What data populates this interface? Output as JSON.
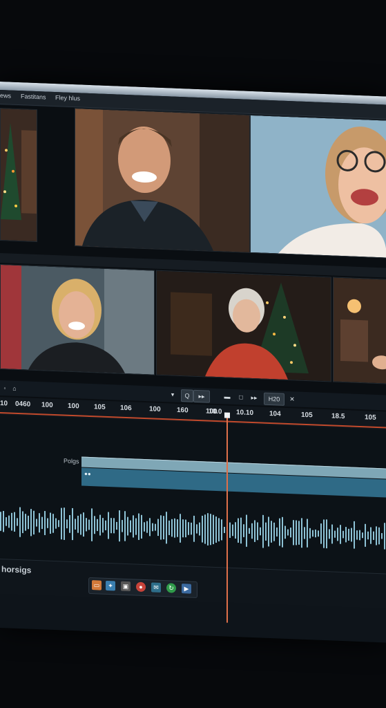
{
  "menu": {
    "items": [
      "ews",
      "Fastitans",
      "Fley hlus"
    ]
  },
  "toolbar": {
    "left_icons": [
      "◦",
      "⌂"
    ],
    "controls": [
      "▾",
      "Q",
      "▸▸",
      "▬",
      "□",
      "▸▸",
      "H20",
      "✕"
    ]
  },
  "ruler": {
    "labels": [
      "10",
      "0460",
      "100",
      "100",
      "105",
      "106",
      "100",
      "160",
      "100",
      "10.0",
      "10.10",
      "104",
      "105",
      "18.5",
      "105"
    ]
  },
  "tracks": {
    "label": "Polgs",
    "clip_marker": "●●"
  },
  "footer": {
    "label": "horsigs",
    "dock_icons": [
      "folder-icon",
      "star-icon",
      "image-icon",
      "record-icon",
      "mail-icon",
      "refresh-icon",
      "media-icon"
    ]
  },
  "colors": {
    "accent_red": "#c24a2c",
    "clip_blue": "#2f6a86",
    "clip_light": "#7fa7b6",
    "waveform": "#8ec3d6"
  }
}
